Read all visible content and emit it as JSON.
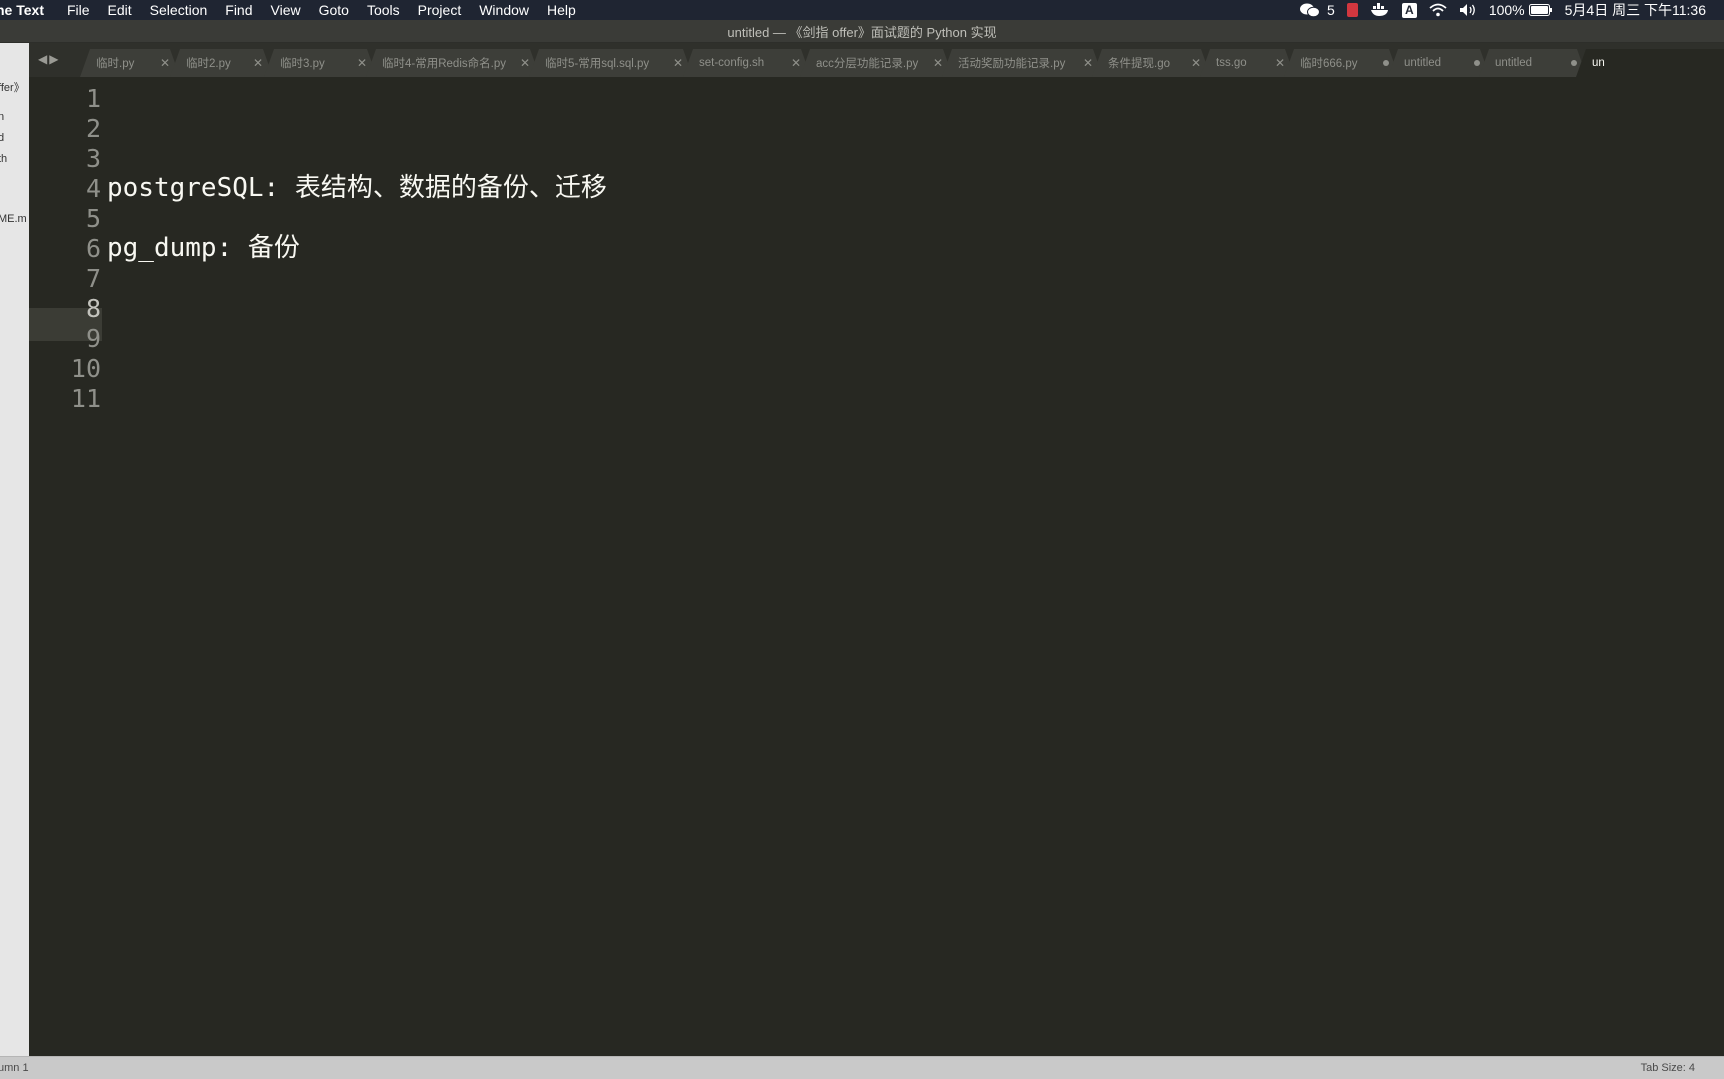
{
  "menubar": {
    "app_name": "ne Text",
    "menus": [
      "File",
      "Edit",
      "Selection",
      "Find",
      "View",
      "Goto",
      "Tools",
      "Project",
      "Window",
      "Help"
    ],
    "wechat_count": "5",
    "battery": "100%",
    "datetime": "5月4日 周三 下午11:36",
    "input_method": "A"
  },
  "window": {
    "title": "untitled — 《剑指 offer》面试题的 Python 实现"
  },
  "sidebar": {
    "items": [
      "ffer》",
      "n",
      "d",
      "th",
      "ME.m"
    ]
  },
  "tabs": [
    {
      "label": "临时.py",
      "state": "close"
    },
    {
      "label": "临时2.py",
      "state": "close"
    },
    {
      "label": "临时3.py",
      "state": "close"
    },
    {
      "label": "临时4-常用Redis命名.py",
      "state": "close"
    },
    {
      "label": "临时5-常用sql.sql.py",
      "state": "close"
    },
    {
      "label": "set-config.sh",
      "state": "close"
    },
    {
      "label": "acc分层功能记录.py",
      "state": "close"
    },
    {
      "label": "活动奖励功能记录.py",
      "state": "close"
    },
    {
      "label": "条件提现.go",
      "state": "close"
    },
    {
      "label": "tss.go",
      "state": "close"
    },
    {
      "label": "临时666.py",
      "state": "dirty"
    },
    {
      "label": "untitled",
      "state": "dirty"
    },
    {
      "label": "untitled",
      "state": "dirty"
    },
    {
      "label": "un",
      "state": "active"
    }
  ],
  "editor": {
    "line_numbers": [
      "1",
      "2",
      "3",
      "4",
      "5",
      "6",
      "7",
      "8",
      "9",
      "10",
      "11"
    ],
    "current_line": 8,
    "lines": [
      "",
      "",
      "",
      "postgreSQL: 表结构、数据的备份、迁移",
      "",
      "pg_dump: 备份",
      "",
      "",
      "",
      "",
      ""
    ]
  },
  "statusbar": {
    "position": "umn 1",
    "tab_size": "Tab Size: 4"
  },
  "colors": {
    "editor_bg": "#272822",
    "foreground": "#f8f8f2",
    "gutter_fg": "#8f908a",
    "current_line": "#3b3c35",
    "menubar_bg": "#1f2532"
  }
}
